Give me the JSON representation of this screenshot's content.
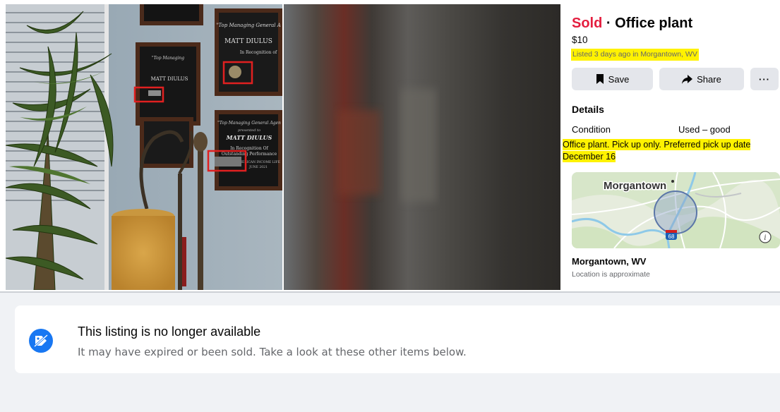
{
  "listing": {
    "status": "Sold",
    "separator": "·",
    "title": "Office plant",
    "price": "$10",
    "listed_text": "Listed 3 days ago in Morgantown, WV"
  },
  "actions": {
    "save_label": "Save",
    "share_label": "Share",
    "more_label": "···"
  },
  "details": {
    "heading": "Details",
    "condition_label": "Condition",
    "condition_value": "Used – good",
    "description": "Office plant. Pick up only. Preferred pick up date December 16"
  },
  "map": {
    "city_label": "Morgantown",
    "highway_shield": "68",
    "info_icon": "info-icon"
  },
  "location": {
    "name": "Morgantown, WV",
    "note": "Location is approximate"
  },
  "photo": {
    "plaque_top_name": "MATT DIULUS",
    "plaque_top_heading": "\"Top Managing General A",
    "plaque_top_line2": "In Recognition of",
    "plaque_bottom_heading": "\"Top Managing General Agen",
    "plaque_bottom_presented": "presented to",
    "plaque_bottom_name": "MATT DIULUS",
    "plaque_bottom_line1": "In Recognition Of",
    "plaque_bottom_line2": "Outstanding Performance",
    "plaque_bottom_company": "AMERICAN INCOME LIFE",
    "plaque_bottom_date": "JUNE 2021",
    "plaque_mid_name": "MATT DIULUS",
    "plaque_mid_heading": "\"Top Managing",
    "highlight_color": "#e02020"
  },
  "notice": {
    "title": "This listing is no longer available",
    "subtitle": "It may have expired or been sold. Take a look at these other items below.",
    "icon": "unavailable-tag-icon"
  },
  "colors": {
    "sold": "#e41e3f",
    "highlight": "#fff200",
    "accent": "#1877f2",
    "button_bg": "#e4e6eb",
    "page_bg": "#f0f2f5"
  }
}
